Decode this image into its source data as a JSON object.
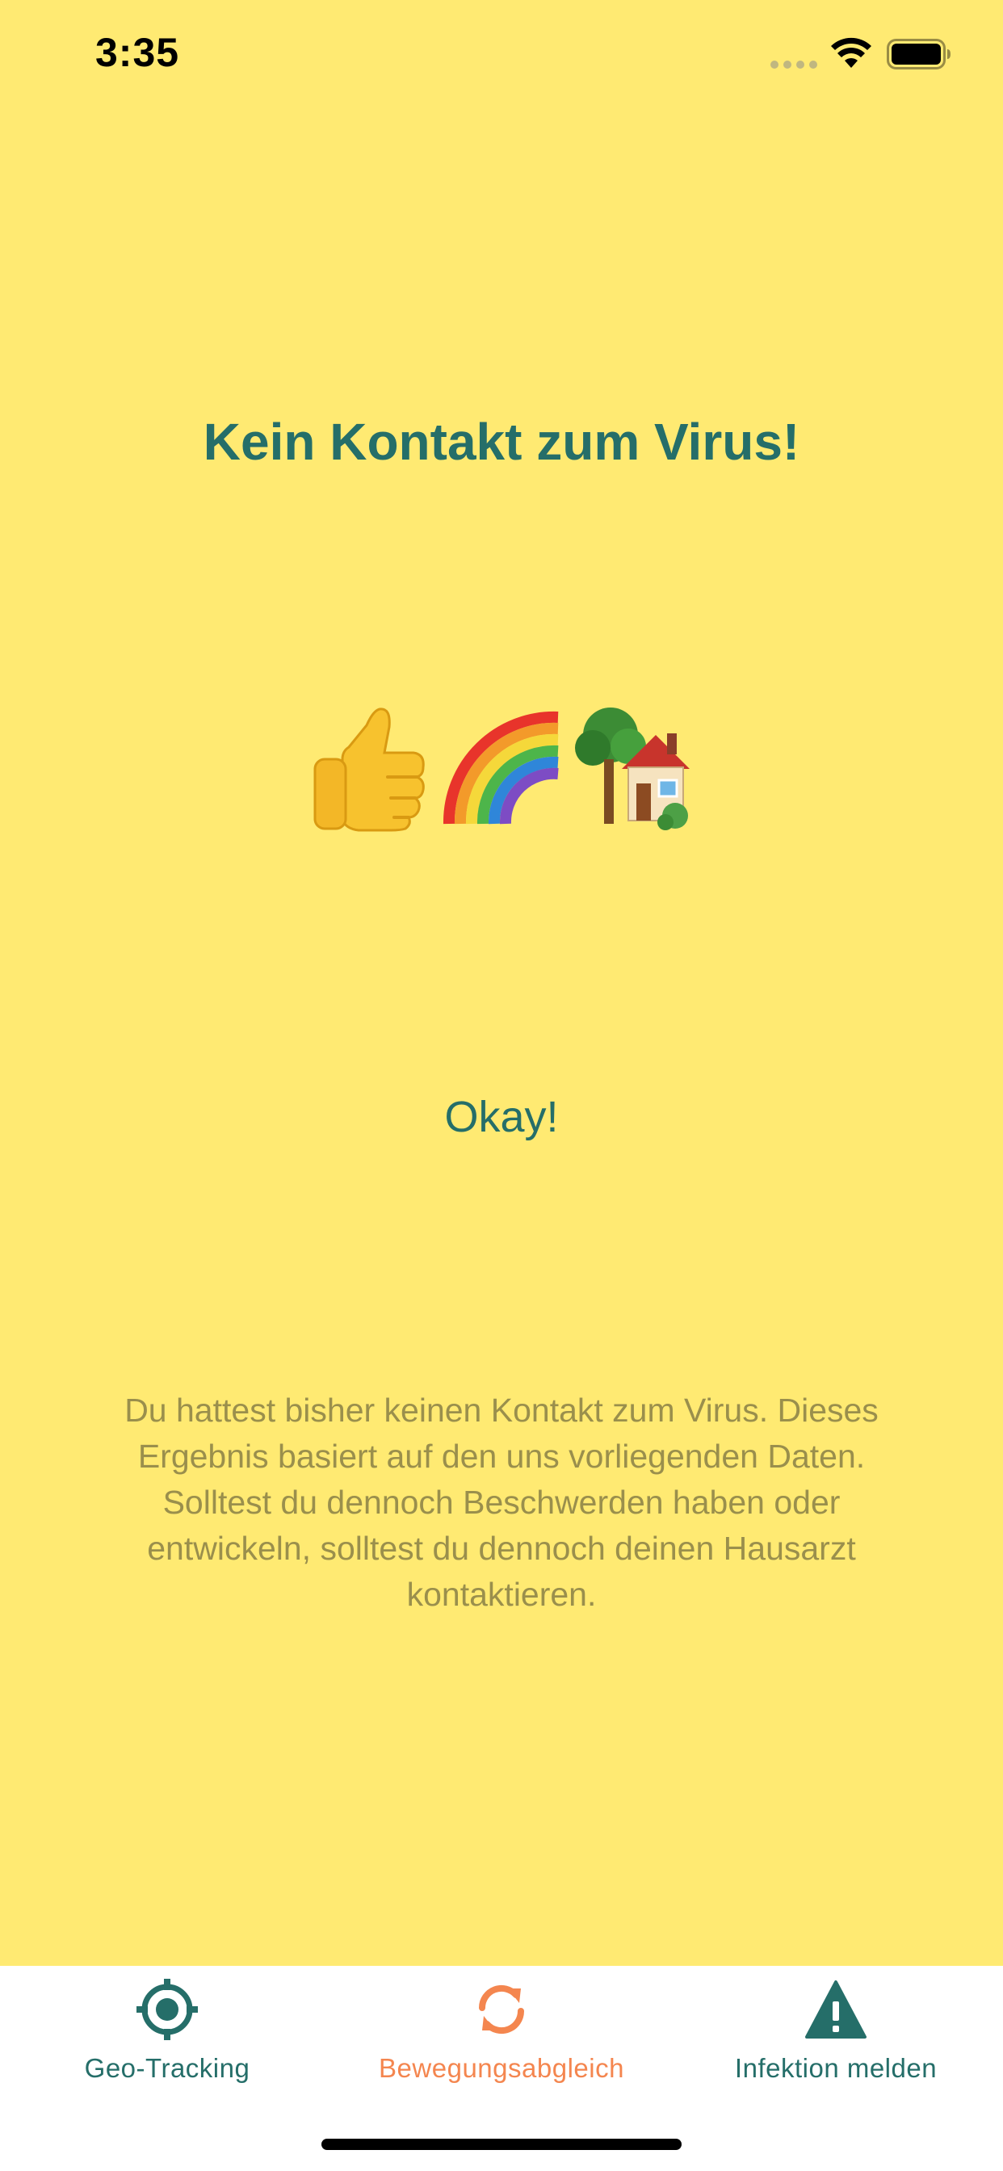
{
  "status_bar": {
    "time": "3:35"
  },
  "main": {
    "title": "Kein Kontakt zum Virus!",
    "emojis": [
      "thumbs-up",
      "rainbow",
      "house-with-garden"
    ],
    "okay_button": "Okay!",
    "description": "Du hattest bisher keinen Kontakt zum Virus. Dieses Ergebnis basiert auf den uns vorliegenden Daten. Solltest du dennoch Beschwerden haben oder entwickeln, solltest du dennoch deinen Hausarzt kontaktieren."
  },
  "tab_bar": {
    "tabs": [
      {
        "label": "Geo-Tracking",
        "icon": "crosshair-icon",
        "active": false
      },
      {
        "label": "Bewegungsabgleich",
        "icon": "sync-icon",
        "active": true
      },
      {
        "label": "Infektion melden",
        "icon": "warning-icon",
        "active": false
      }
    ]
  },
  "colors": {
    "background": "#FFEA72",
    "primary_teal": "#256E69",
    "active_orange": "#F4864F",
    "body_text": "#9A8F4C",
    "tab_bar_bg": "#FFFFFF"
  }
}
